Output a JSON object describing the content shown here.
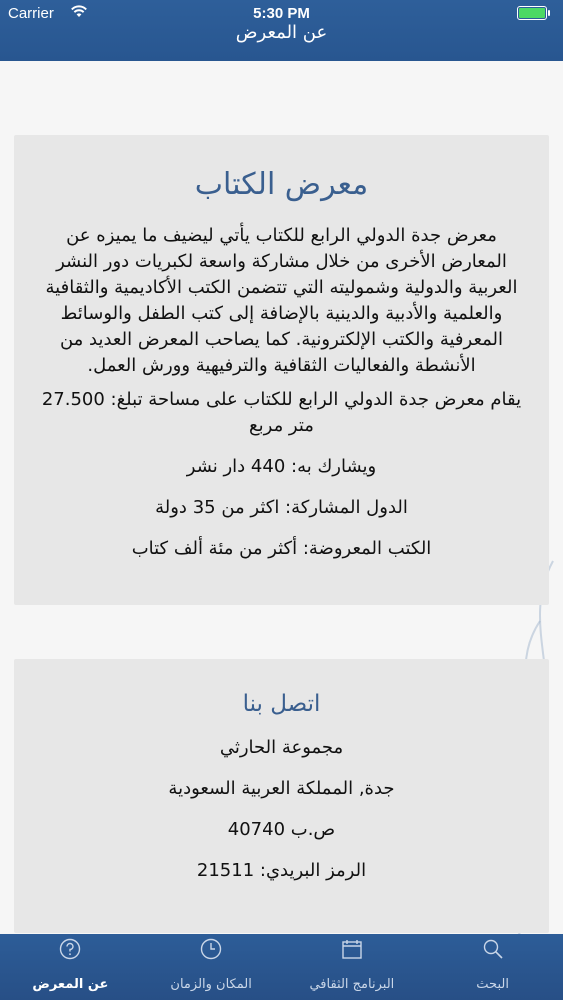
{
  "status_bar": {
    "carrier": "Carrier",
    "time": "5:30 PM"
  },
  "header": {
    "title": "عن المعرض"
  },
  "about_card": {
    "title": "معرض الكتاب",
    "intro": "معرض جدة الدولي الرابع للكتاب يأتي ليضيف ما يميزه عن المعارض الأخرى من خلال مشاركة واسعة لكبريات دور النشر العربية والدولية وشموليته التي تتضمن الكتب الأكاديمية والثقافية والعلمية والأدبية والدينية بالإضافة إلى كتب الطفل والوسائط المعرفية والكتب الإلكترونية. كما يصاحب المعرض العديد من الأنشطة والفعاليات الثقافية والترفيهية وورش العمل.",
    "area": "يقام معرض جدة الدولي الرابع للكتاب على مساحة تبلغ: 27.500 متر مربع",
    "publishers": "ويشارك به: 440 دار نشر",
    "countries": "الدول المشاركة: اكثر من 35 دولة",
    "books": "الكتب المعروضة: أكثر من مئة ألف كتاب"
  },
  "contact_card": {
    "title": "اتصل بنا",
    "company": "مجموعة الحارثي",
    "city": "جدة, المملكة العربية السعودية",
    "po_box": "ص.ب 40740",
    "postal_code": "الرمز البريدي: 21511"
  },
  "tab_bar": {
    "tabs": [
      {
        "label": "عن المعرض",
        "icon": "question-circle-icon",
        "active": true
      },
      {
        "label": "المكان والزمان",
        "icon": "clock-icon",
        "active": false
      },
      {
        "label": "البرنامج الثقافي",
        "icon": "calendar-icon",
        "active": false
      },
      {
        "label": "البحث",
        "icon": "search-icon",
        "active": false
      }
    ]
  },
  "colors": {
    "header_bg": "#2b5a94",
    "card_bg": "#e7e7e7",
    "title_color": "#3a5f8f",
    "battery_fill": "#4cd964"
  }
}
